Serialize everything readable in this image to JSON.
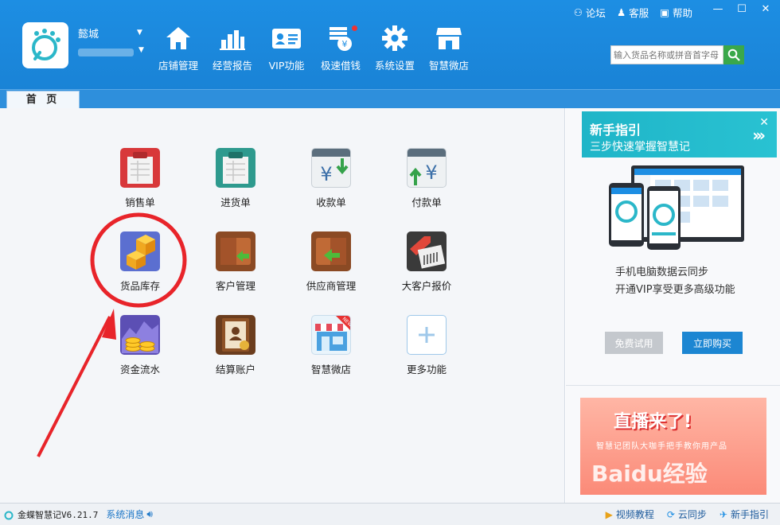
{
  "toplinks": {
    "forum": "论坛",
    "service": "客服",
    "help": "帮助"
  },
  "user": {
    "name": "懿城"
  },
  "nav": [
    {
      "label": "店铺管理",
      "icon": "home-icon"
    },
    {
      "label": "经营报告",
      "icon": "bar-chart-icon"
    },
    {
      "label": "VIP功能",
      "icon": "vip-card-icon"
    },
    {
      "label": "极速借钱",
      "icon": "loan-icon"
    },
    {
      "label": "系统设置",
      "icon": "gear-icon"
    },
    {
      "label": "智慧微店",
      "icon": "shop-icon"
    }
  ],
  "search": {
    "placeholder": "输入货品名称或拼音首字母"
  },
  "tab": {
    "home": "首 页"
  },
  "grid": [
    {
      "label": "销售单",
      "icon": "sales-order-icon"
    },
    {
      "label": "进货单",
      "icon": "purchase-order-icon"
    },
    {
      "label": "收款单",
      "icon": "receipt-icon"
    },
    {
      "label": "付款单",
      "icon": "payment-icon"
    },
    {
      "label": "货品库存",
      "icon": "inventory-icon"
    },
    {
      "label": "客户管理",
      "icon": "customer-icon"
    },
    {
      "label": "供应商管理",
      "icon": "supplier-icon"
    },
    {
      "label": "大客户报价",
      "icon": "price-tag-icon"
    },
    {
      "label": "资金流水",
      "icon": "cash-flow-icon"
    },
    {
      "label": "结算账户",
      "icon": "account-book-icon"
    },
    {
      "label": "智慧微店",
      "icon": "micro-shop-icon"
    },
    {
      "label": "更多功能",
      "icon": "plus-icon"
    }
  ],
  "side": {
    "guide_title": "新手指引",
    "guide_sub": "三步快速掌握智慧记",
    "desc1": "手机电脑数据云同步",
    "desc2": "开通VIP享受更多高级功能",
    "trial": "免费试用",
    "buy": "立即购买",
    "banner_title": "直播来了!",
    "banner_sub": "智慧记团队大咖手把手教你用产品",
    "watermark": "Baidu经验"
  },
  "status": {
    "version": "金蝶智慧记V6.21.7",
    "message": "系统消息",
    "video": "视频教程",
    "cloud": "云同步",
    "guide": "新手指引"
  },
  "colors": {
    "header": "#1d8ee3",
    "accent_green": "#3aa84a",
    "annotation": "#e8242a"
  }
}
